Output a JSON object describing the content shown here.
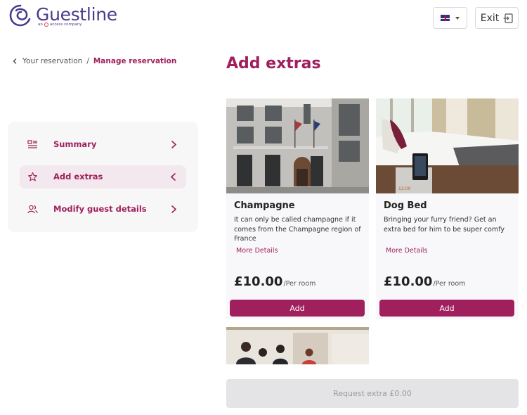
{
  "header": {
    "brand_name": "Guestline",
    "brand_tagline_prefix": "an",
    "brand_tagline_suffix": "access company",
    "language_icon": "uk-flag-icon",
    "exit_label": "Exit"
  },
  "breadcrumb": {
    "parent": "Your reservation",
    "separator": "/",
    "current": "Manage reservation"
  },
  "sidebar": {
    "items": [
      {
        "label": "Summary",
        "icon": "list-icon",
        "active": false
      },
      {
        "label": "Add extras",
        "icon": "star-icon",
        "active": true
      },
      {
        "label": "Modify guest details",
        "icon": "users-icon",
        "active": false
      }
    ]
  },
  "main": {
    "title": "Add extras",
    "extras": [
      {
        "title": "Champagne",
        "description": "It can only be called champagne if it comes from the Champagne region of France",
        "more_label": "More Details",
        "price": "£10.00",
        "unit": "/Per room",
        "add_label": "Add"
      },
      {
        "title": "Dog Bed",
        "description": "Bringing your furry friend? Get an extra bed for him to be super comfy",
        "more_label": "More Details",
        "price": "£10.00",
        "unit": "/Per room",
        "add_label": "Add"
      }
    ],
    "request_label": "Request extra £0.00"
  },
  "colors": {
    "brand": "#a0205d",
    "logo": "#4b3a8c",
    "disabled_bg": "#e4e4e6"
  }
}
